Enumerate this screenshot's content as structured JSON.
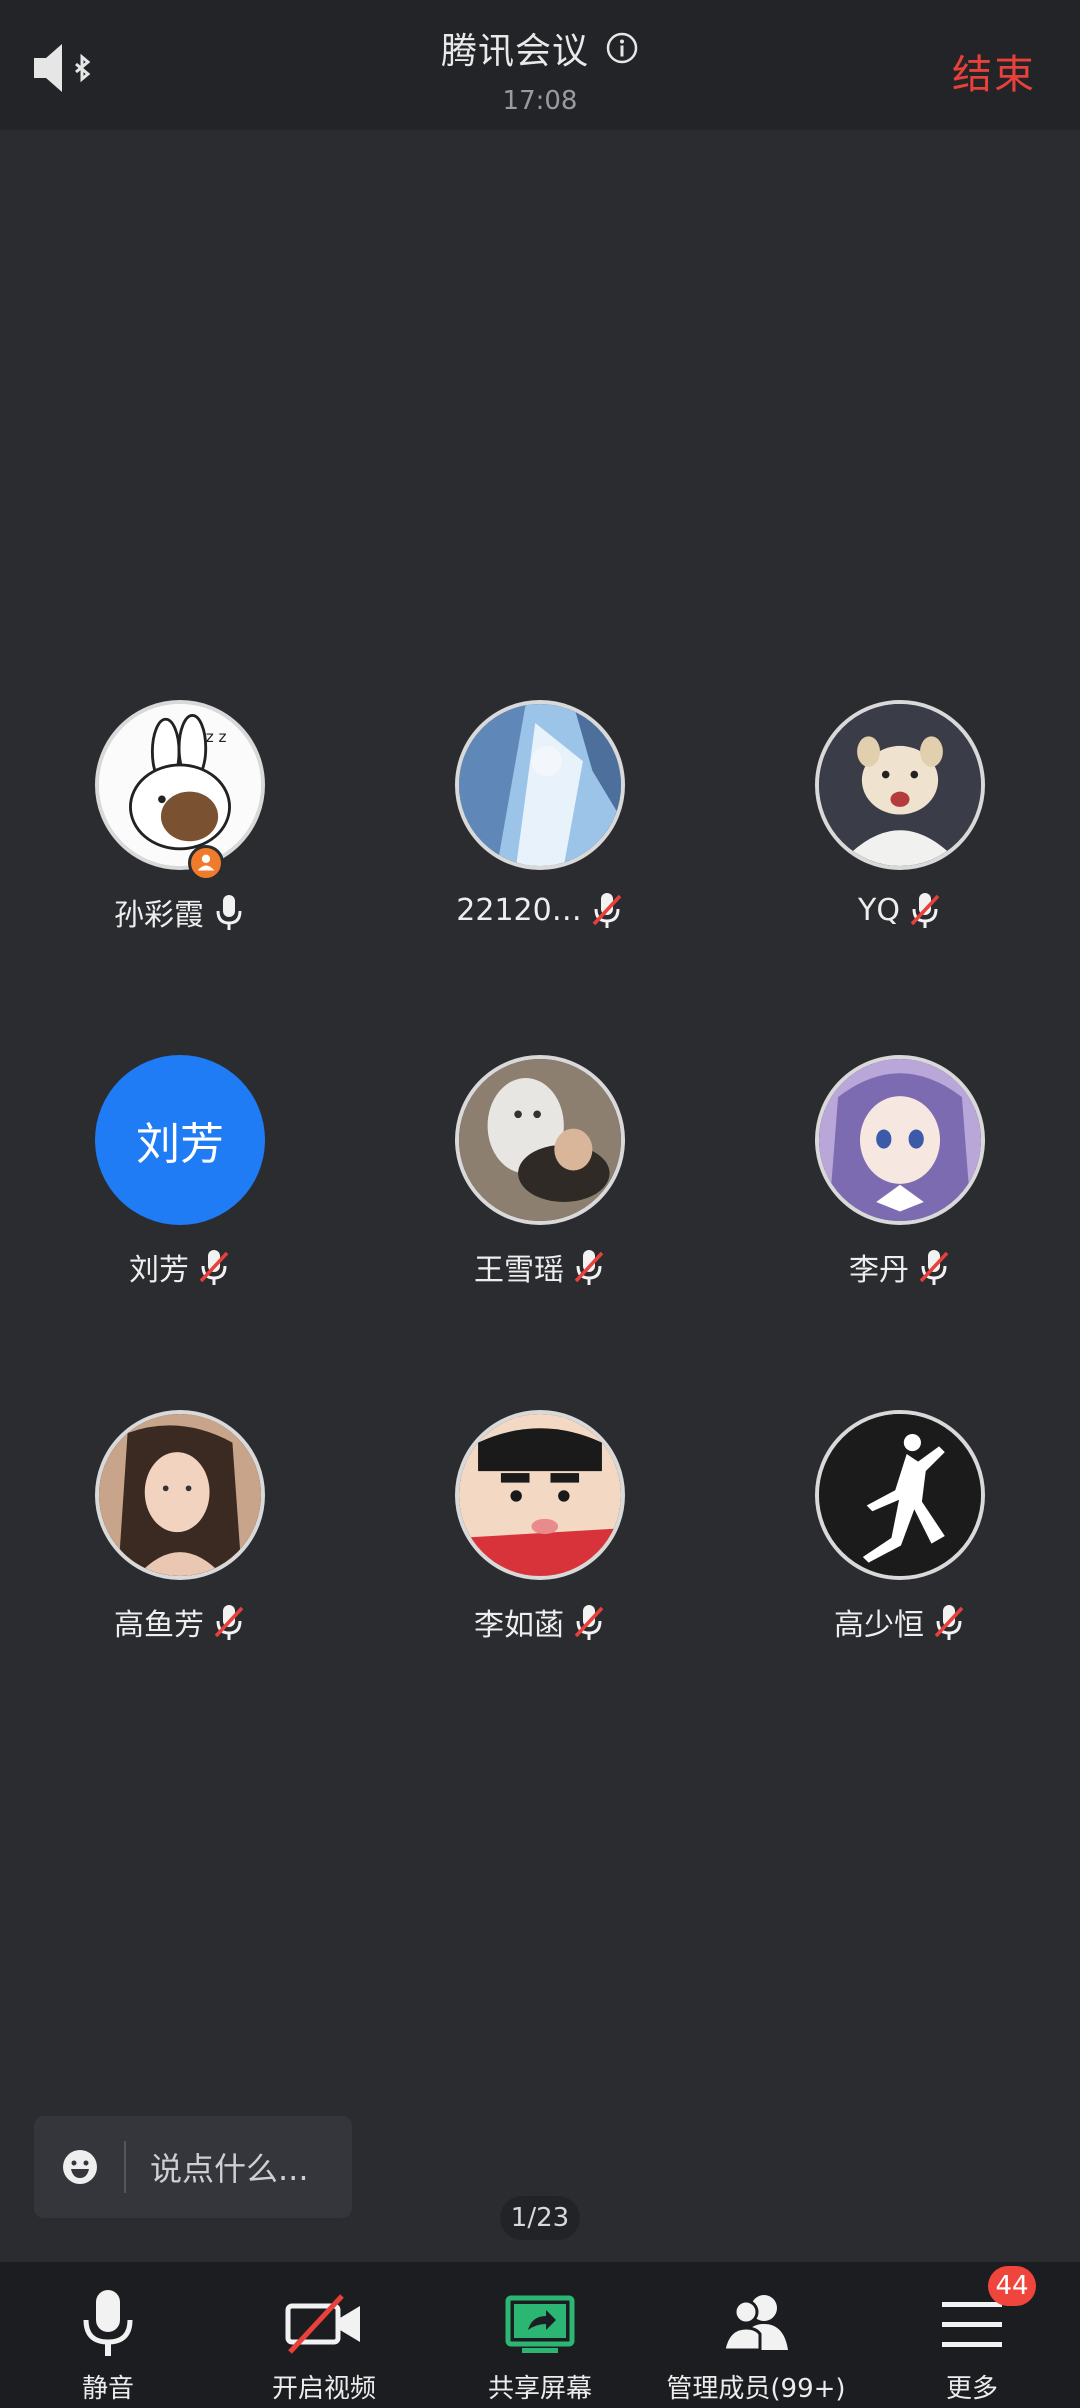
{
  "header": {
    "speaker_icon": "speaker-bluetooth-icon",
    "title": "腾讯会议",
    "time": "17:08",
    "end_label": "结束",
    "end_color": "#e8413b"
  },
  "participants": [
    {
      "name": "孙彩霞",
      "mic": "on",
      "avatar": "cartoon-bunny",
      "host": true
    },
    {
      "name": "22120…",
      "mic": "muted",
      "avatar": "blue-anime"
    },
    {
      "name": "YQ",
      "mic": "muted",
      "avatar": "white-dog"
    },
    {
      "name": "刘芳",
      "mic": "muted",
      "avatar": "text",
      "avatar_text": "刘芳",
      "avatar_color": "#1f7cf5"
    },
    {
      "name": "王雪瑶",
      "mic": "muted",
      "avatar": "photo-cat"
    },
    {
      "name": "李丹",
      "mic": "muted",
      "avatar": "anime-girl"
    },
    {
      "name": "高鱼芳",
      "mic": "muted",
      "avatar": "photo-woman"
    },
    {
      "name": "李如菡",
      "mic": "muted",
      "avatar": "crayon-shin"
    },
    {
      "name": "高少恒",
      "mic": "muted",
      "avatar": "jumpman-logo"
    }
  ],
  "chat": {
    "placeholder": "说点什么..."
  },
  "page_indicator": "1/23",
  "toolbar": {
    "mute_label": "静音",
    "video_label": "开启视频",
    "share_label": "共享屏幕",
    "members_label": "管理成员(99+)",
    "more_label": "更多",
    "more_badge": "44"
  },
  "colors": {
    "background": "#2b2c30",
    "toolbar": "#1c1d20",
    "accent_green": "#2bb673",
    "muted_red": "#e8413b"
  }
}
